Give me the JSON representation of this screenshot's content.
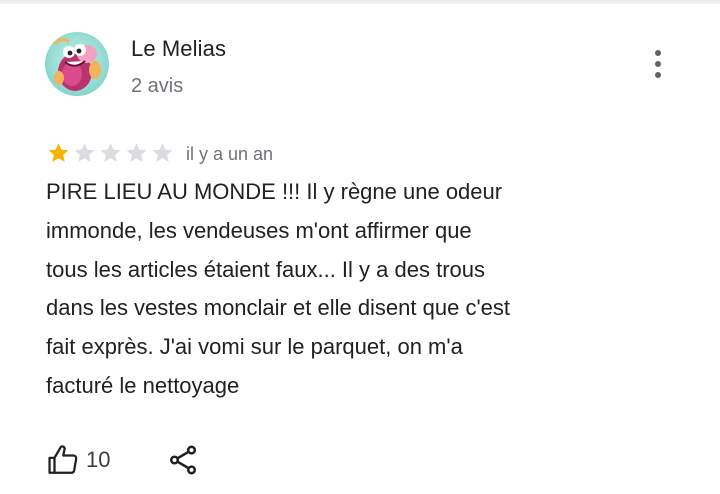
{
  "review": {
    "author": {
      "name": "Le Melias",
      "meta": "2 avis",
      "avatar_icon": "cartoon-character-avatar"
    },
    "rating": {
      "value": 1,
      "max": 5,
      "filled_color": "#f6b400",
      "empty_color": "#dadce0"
    },
    "date": "il y a un an",
    "text": "PIRE LIEU AU MONDE !!! Il y règne une odeur\nimmonde, les vendeuses m'ont affirmer que\ntous les articles étaient faux... Il y a des trous\ndans les vestes monclair et elle disent que c'est\nfait exprès. J'ai vomi sur le parquet, on m'a\nfacturé le nettoyage",
    "actions": {
      "like_count": "10",
      "like_icon": "thumb-up-icon",
      "share_icon": "share-icon",
      "more_icon": "more-vertical-icon"
    }
  }
}
